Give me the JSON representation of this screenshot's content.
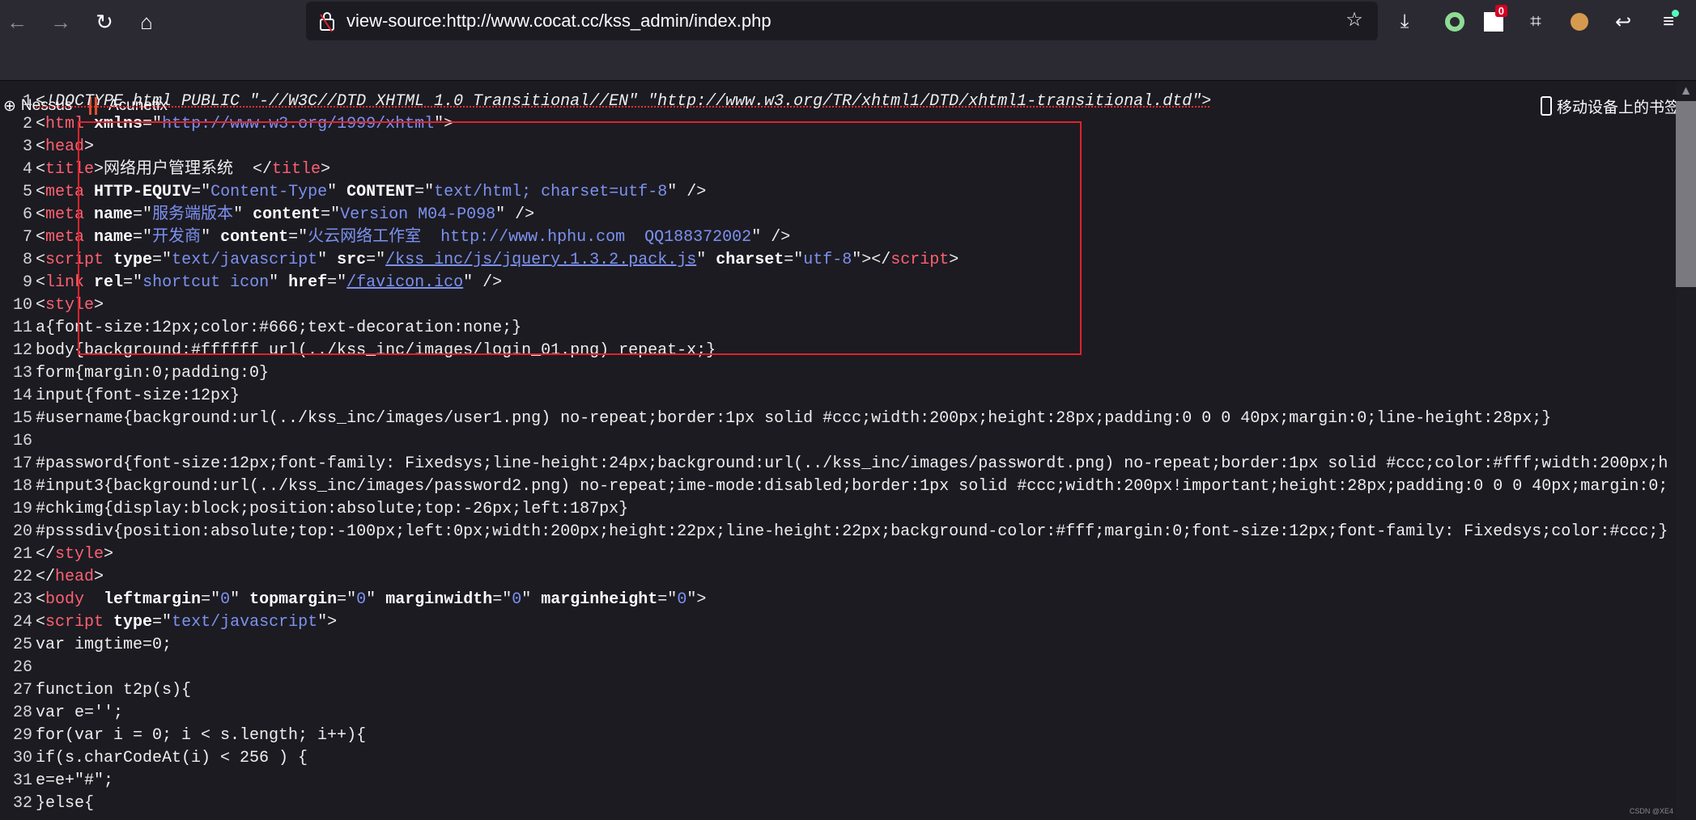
{
  "toolbar": {
    "url": "view-source:http://www.cocat.cc/kss_admin/index.php",
    "badge_count": "0",
    "accent": "#e0222a"
  },
  "bookmarks": {
    "items": [
      {
        "label": "Nessus",
        "icon": "globe-icon"
      },
      {
        "label": "Acunetix",
        "icon": "acunetix-icon"
      }
    ],
    "mobile": "移动设备上的书签"
  },
  "watermark": "CSDN @XE4",
  "code": [
    [
      [
        "c",
        "<!DOCTYPE html PUBLIC \"-//W3C//DTD XHTML 1.0 Transitional//EN\" \"http://www.w3.org/TR/xhtml1/DTD/xhtml1-transitional.dtd\">"
      ]
    ],
    [
      [
        "p",
        "<"
      ],
      [
        "t",
        "html"
      ],
      [
        "a",
        " xmlns"
      ],
      [
        "p",
        "=\""
      ],
      [
        "v",
        "http://www.w3.org/1999/xhtml"
      ],
      [
        "p",
        "\">"
      ]
    ],
    [
      [
        "p",
        "<"
      ],
      [
        "t",
        "head"
      ],
      [
        "p",
        ">"
      ]
    ],
    [
      [
        "p",
        "<"
      ],
      [
        "t",
        "title"
      ],
      [
        "p",
        ">网络用户管理系统  </"
      ],
      [
        "t",
        "title"
      ],
      [
        "p",
        ">"
      ]
    ],
    [
      [
        "p",
        "<"
      ],
      [
        "t",
        "meta"
      ],
      [
        "a",
        " HTTP-EQUIV"
      ],
      [
        "p",
        "=\""
      ],
      [
        "v",
        "Content-Type"
      ],
      [
        "p",
        "\""
      ],
      [
        "a",
        " CONTENT"
      ],
      [
        "p",
        "=\""
      ],
      [
        "v",
        "text/html; charset=utf-8"
      ],
      [
        "p",
        "\" />"
      ]
    ],
    [
      [
        "p",
        "<"
      ],
      [
        "t",
        "meta"
      ],
      [
        "a",
        " name"
      ],
      [
        "p",
        "=\""
      ],
      [
        "v",
        "服务端版本"
      ],
      [
        "p",
        "\""
      ],
      [
        "a",
        " content"
      ],
      [
        "p",
        "=\""
      ],
      [
        "v",
        "Version M04-P098"
      ],
      [
        "p",
        "\" />"
      ]
    ],
    [
      [
        "p",
        "<"
      ],
      [
        "t",
        "meta"
      ],
      [
        "a",
        " name"
      ],
      [
        "p",
        "=\""
      ],
      [
        "v",
        "开发商"
      ],
      [
        "p",
        "\""
      ],
      [
        "a",
        " content"
      ],
      [
        "p",
        "=\""
      ],
      [
        "v",
        "火云网络工作室  http://www.hphu.com  QQ188372002"
      ],
      [
        "p",
        "\" />"
      ]
    ],
    [
      [
        "p",
        "<"
      ],
      [
        "t",
        "script"
      ],
      [
        "a",
        " type"
      ],
      [
        "p",
        "=\""
      ],
      [
        "v",
        "text/javascript"
      ],
      [
        "p",
        "\""
      ],
      [
        "a",
        " src"
      ],
      [
        "p",
        "=\""
      ],
      [
        "l",
        "/kss_inc/js/jquery.1.3.2.pack.js"
      ],
      [
        "p",
        "\""
      ],
      [
        "a",
        " charset"
      ],
      [
        "p",
        "=\""
      ],
      [
        "v",
        "utf-8"
      ],
      [
        "p",
        "\"></"
      ],
      [
        "t",
        "script"
      ],
      [
        "p",
        ">"
      ]
    ],
    [
      [
        "p",
        "<"
      ],
      [
        "t",
        "link"
      ],
      [
        "a",
        " rel"
      ],
      [
        "p",
        "=\""
      ],
      [
        "v",
        "shortcut icon"
      ],
      [
        "p",
        "\""
      ],
      [
        "a",
        " href"
      ],
      [
        "p",
        "=\""
      ],
      [
        "l",
        "/favicon.ico"
      ],
      [
        "p",
        "\" />"
      ]
    ],
    [
      [
        "p",
        "<"
      ],
      [
        "t",
        "style"
      ],
      [
        "p",
        ">"
      ]
    ],
    [
      [
        "p",
        "a{font-size:12px;color:#666;text-decoration:none;}"
      ]
    ],
    [
      [
        "p",
        "body{background:#ffffff url(../kss_inc/images/login_01.png) repeat-x;}"
      ]
    ],
    [
      [
        "p",
        "form{margin:0;padding:0}"
      ]
    ],
    [
      [
        "p",
        "input{font-size:12px}"
      ]
    ],
    [
      [
        "p",
        "#username{background:url(../kss_inc/images/user1.png) no-repeat;border:1px solid #ccc;width:200px;height:28px;padding:0 0 0 40px;margin:0;line-height:28px;}"
      ]
    ],
    [],
    [
      [
        "p",
        "#password{font-size:12px;font-family: Fixedsys;line-height:24px;background:url(../kss_inc/images/passwordt.png) no-repeat;border:1px solid #ccc;color:#fff;width:200px;h"
      ]
    ],
    [
      [
        "p",
        "#input3{background:url(../kss_inc/images/password2.png) no-repeat;ime-mode:disabled;border:1px solid #ccc;width:200px!important;height:28px;padding:0 0 0 40px;margin:0;"
      ]
    ],
    [
      [
        "p",
        "#chkimg{display:block;position:absolute;top:-26px;left:187px}"
      ]
    ],
    [
      [
        "p",
        "#psssdiv{position:absolute;top:-100px;left:0px;width:200px;height:22px;line-height:22px;background-color:#fff;margin:0;font-size:12px;font-family: Fixedsys;color:#ccc;}"
      ]
    ],
    [
      [
        "p",
        "</"
      ],
      [
        "t",
        "style"
      ],
      [
        "p",
        ">"
      ]
    ],
    [
      [
        "p",
        "</"
      ],
      [
        "t",
        "head"
      ],
      [
        "p",
        ">"
      ]
    ],
    [
      [
        "p",
        "<"
      ],
      [
        "t",
        "body"
      ],
      [
        "a",
        "  leftmargin"
      ],
      [
        "p",
        "=\""
      ],
      [
        "v",
        "0"
      ],
      [
        "p",
        "\""
      ],
      [
        "a",
        " topmargin"
      ],
      [
        "p",
        "=\""
      ],
      [
        "v",
        "0"
      ],
      [
        "p",
        "\""
      ],
      [
        "a",
        " marginwidth"
      ],
      [
        "p",
        "=\""
      ],
      [
        "v",
        "0"
      ],
      [
        "p",
        "\""
      ],
      [
        "a",
        " marginheight"
      ],
      [
        "p",
        "=\""
      ],
      [
        "v",
        "0"
      ],
      [
        "p",
        "\">"
      ]
    ],
    [
      [
        "p",
        "<"
      ],
      [
        "t",
        "script"
      ],
      [
        "a",
        " type"
      ],
      [
        "p",
        "=\""
      ],
      [
        "v",
        "text/javascript"
      ],
      [
        "p",
        "\">"
      ]
    ],
    [
      [
        "p",
        "var imgtime=0;"
      ]
    ],
    [],
    [
      [
        "p",
        "function t2p(s){"
      ]
    ],
    [
      [
        "p",
        "var e='';"
      ]
    ],
    [
      [
        "p",
        "for(var i = 0; i < s.length; i++){"
      ]
    ],
    [
      [
        "p",
        "if(s.charCodeAt(i) < 256 ) {"
      ]
    ],
    [
      [
        "p",
        "e=e+\"#\";"
      ]
    ],
    [
      [
        "p",
        "}else{"
      ]
    ]
  ]
}
